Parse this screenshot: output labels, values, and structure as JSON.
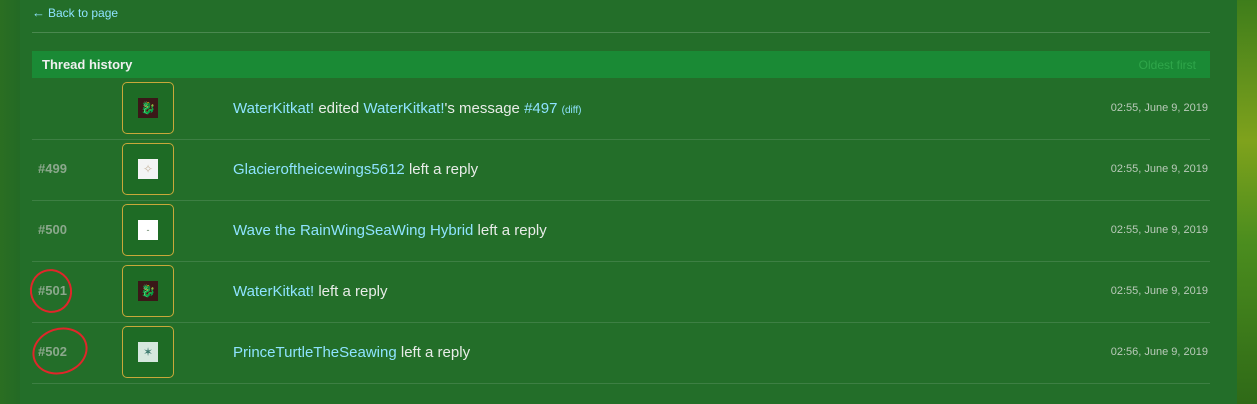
{
  "nav": {
    "back_label": "Back to page"
  },
  "thread_history": {
    "title": "Thread history",
    "sort_label": "Oldest first",
    "rows": [
      {
        "post_number": "",
        "avatar_icon": "dragon-avatar",
        "user": "WaterKitkat!",
        "action": "edited",
        "target_user": "WaterKitkat!",
        "message_suffix": "'s message",
        "message_ref": "#497",
        "diff_label": "(diff)",
        "timestamp": "02:55, June 9, 2019"
      },
      {
        "post_number": "#499",
        "avatar_icon": "pale-avatar",
        "user": "Glacieroftheicewings5612",
        "action": "left a reply",
        "timestamp": "02:55, June 9, 2019"
      },
      {
        "post_number": "#500",
        "avatar_icon": "white-avatar",
        "user": "Wave the RainWingSeaWing Hybrid",
        "action": "left a reply",
        "timestamp": "02:55, June 9, 2019"
      },
      {
        "post_number": "#501",
        "avatar_icon": "dragon-avatar",
        "user": "WaterKitkat!",
        "action": "left a reply",
        "timestamp": "02:55, June 9, 2019"
      },
      {
        "post_number": "#502",
        "avatar_icon": "seawing-avatar",
        "user": "PrinceTurtleTheSeawing",
        "action": "left a reply",
        "timestamp": "02:56, June 9, 2019"
      }
    ]
  },
  "colors": {
    "link": "#8fe3ff",
    "header_bar": "#1a8a35",
    "annotation": "#e0262a"
  }
}
